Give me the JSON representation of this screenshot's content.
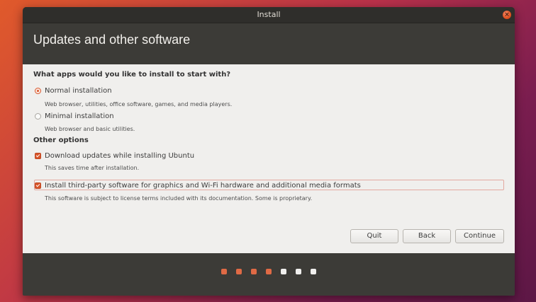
{
  "window": {
    "title": "Install",
    "close_symbol": "×"
  },
  "header": {
    "title": "Updates and other software"
  },
  "apps": {
    "question": "What apps would you like to install to start with?",
    "normal": {
      "label": "Normal installation",
      "description": "Web browser, utilities, office software, games, and media players.",
      "selected": true
    },
    "minimal": {
      "label": "Minimal installation",
      "description": "Web browser and basic utilities.",
      "selected": false
    }
  },
  "other": {
    "heading": "Other options",
    "download_updates": {
      "label": "Download updates while installing Ubuntu",
      "description": "This saves time after installation.",
      "checked": true
    },
    "third_party": {
      "label": "Install third-party software for graphics and Wi-Fi hardware and additional media formats",
      "description": "This software is subject to license terms included with its documentation. Some is proprietary.",
      "checked": true
    }
  },
  "buttons": {
    "quit": "Quit",
    "back": "Back",
    "continue": "Continue"
  },
  "progress": {
    "total_steps": 7,
    "completed_steps": 4
  },
  "colors": {
    "accent": "#d7552a",
    "window_dark": "#3c3b37",
    "content_bg": "#f0efed"
  }
}
